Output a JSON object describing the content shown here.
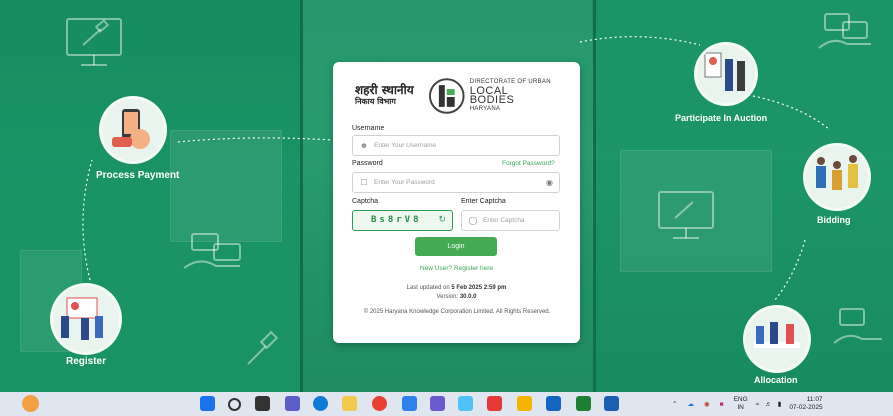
{
  "steps": {
    "process_payment": "Process Payment",
    "register": "Register",
    "participate": "Participate In Auction",
    "bidding": "Bidding",
    "allocation": "Allocation"
  },
  "logo": {
    "hindi_line1": "शहरी स्थानीय",
    "hindi_line2": "निकाय विभाग",
    "en_line1": "DIRECTORATE OF URBAN",
    "en_line2": "LOCAL BODIES",
    "en_line3": "HARYANA"
  },
  "form": {
    "username_label": "Username",
    "username_placeholder": "Enter Your Username",
    "password_label": "Password",
    "forgot_password": "Forgot Password?",
    "password_placeholder": "Enter Your Password",
    "captcha_label": "Captcha",
    "captcha_value": "Bs8rV8",
    "enter_captcha_label": "Enter Captcha",
    "captcha_placeholder": "Enter Captcha",
    "login_button": "Login",
    "register_link": "New User? Register here"
  },
  "footer": {
    "last_updated_prefix": "Last updated on",
    "last_updated_value": "5 Feb 2025 2:59 pm",
    "version_prefix": "Version:",
    "version_value": "30.0.0",
    "copyright": "© 2025 Haryana Knowledge Corporation Limited. All Rights Reserved."
  },
  "taskbar": {
    "lang_line1": "ENG",
    "lang_line2": "IN",
    "time": "11:07",
    "date": "07-02-2025"
  },
  "colors": {
    "brand_green": "#46a953",
    "bg_green": "#1f8f67"
  }
}
